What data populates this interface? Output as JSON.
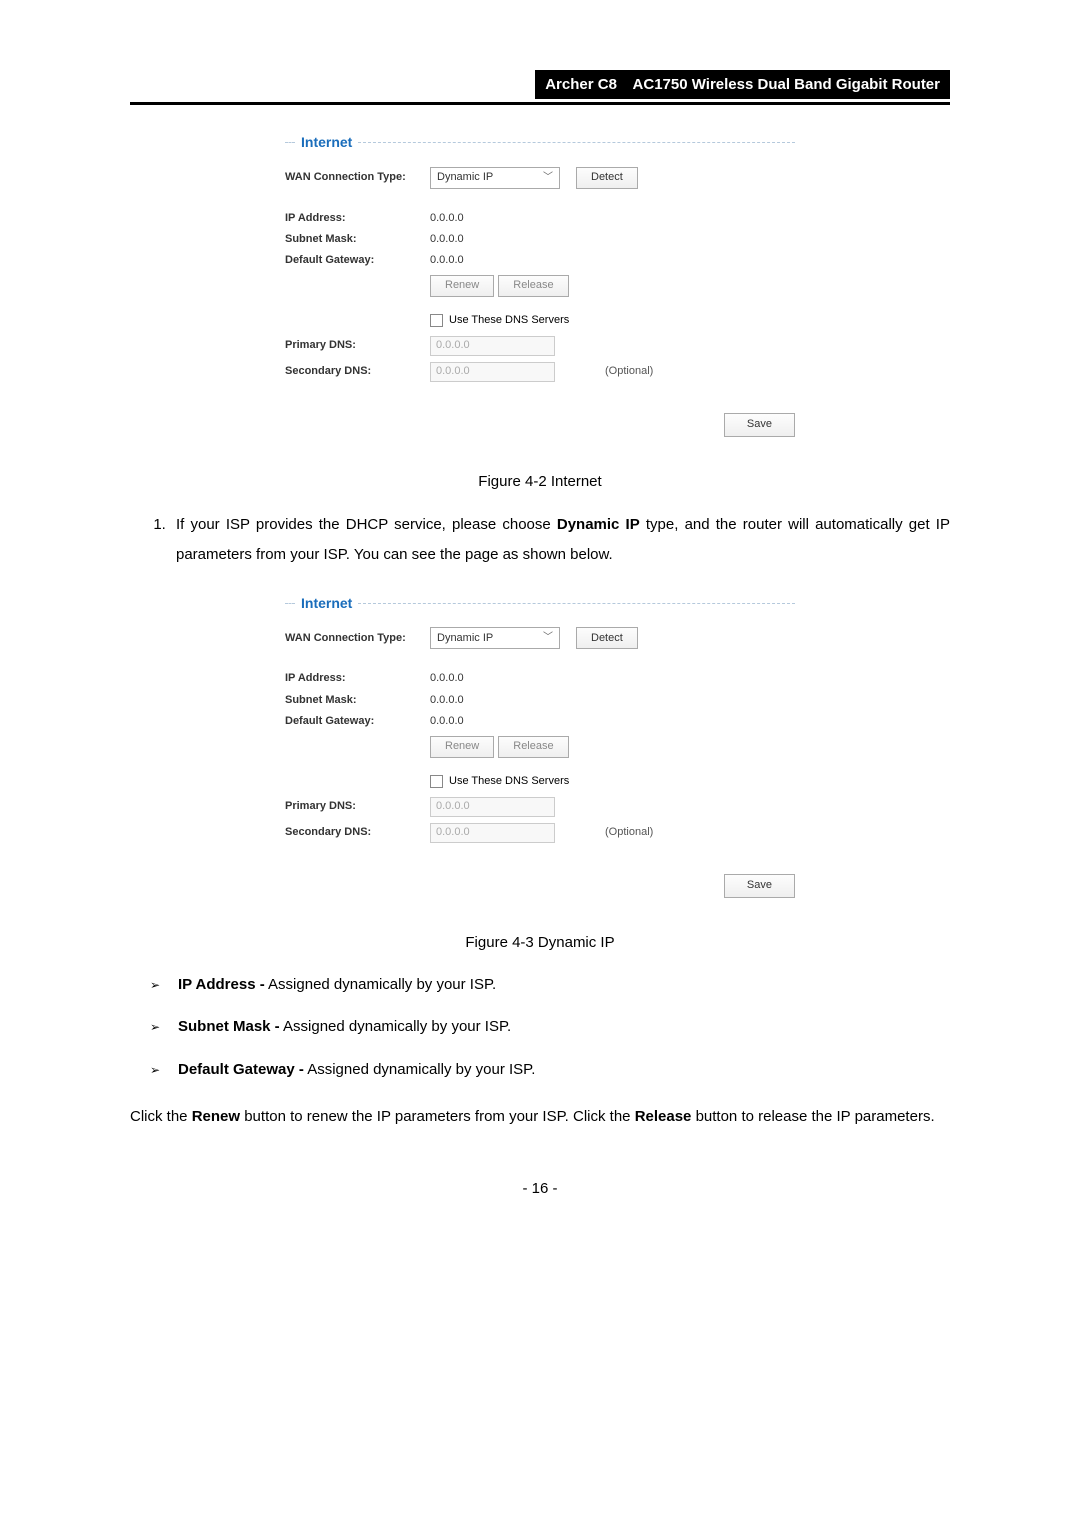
{
  "header": {
    "model": "Archer C8",
    "product": "AC1750 Wireless Dual Band Gigabit Router"
  },
  "panel": {
    "title": "Internet",
    "wan_label": "WAN Connection Type:",
    "wan_value": "Dynamic IP",
    "detect_label": "Detect",
    "ip_label": "IP Address:",
    "ip_value": "0.0.0.0",
    "subnet_label": "Subnet Mask:",
    "subnet_value": "0.0.0.0",
    "gateway_label": "Default Gateway:",
    "gateway_value": "0.0.0.0",
    "renew_label": "Renew",
    "release_label": "Release",
    "use_dns_label": "Use These DNS Servers",
    "primary_dns_label": "Primary DNS:",
    "primary_dns_value": "0.0.0.0",
    "secondary_dns_label": "Secondary DNS:",
    "secondary_dns_value": "0.0.0.0",
    "optional": "(Optional)",
    "save_label": "Save"
  },
  "captions": {
    "fig42": "Figure 4-2 Internet",
    "fig43": "Figure 4-3 Dynamic IP"
  },
  "text": {
    "list1_a": "If your ISP provides the DHCP service, please choose ",
    "list1_b": "Dynamic IP",
    "list1_c": " type, and the router will automatically get IP parameters from your ISP. You can see the page as shown below.",
    "def_ip_b": "IP Address -",
    "def_ip_t": " Assigned dynamically by your ISP.",
    "def_sm_b": "Subnet Mask -",
    "def_sm_t": " Assigned dynamically by your ISP.",
    "def_gw_b": "Default Gateway -",
    "def_gw_t": " Assigned dynamically by your ISP.",
    "para2_a": "Click the ",
    "para2_b": "Renew",
    "para2_c": " button to renew the IP parameters from your ISP. Click the ",
    "para2_d": "Release",
    "para2_e": " button to release the IP parameters."
  },
  "page_num": "- 16 -"
}
